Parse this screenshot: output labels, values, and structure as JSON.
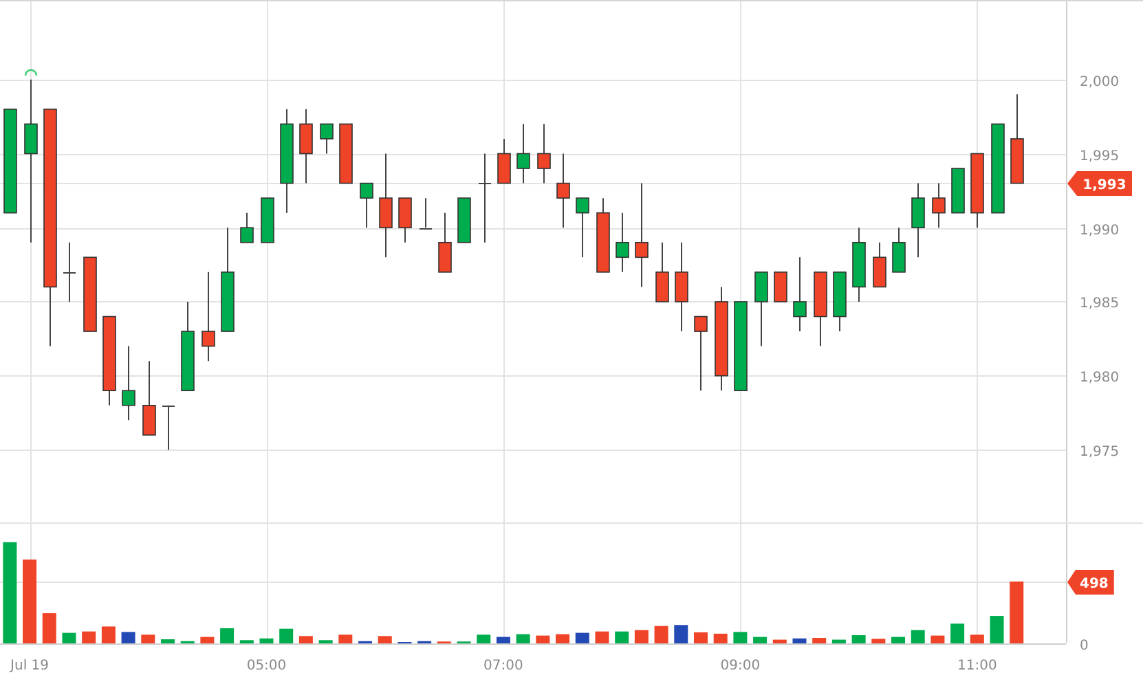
{
  "price_chart": {
    "chart_data": {
      "type": "candlestick",
      "grid": true,
      "categories": [
        null,
        null,
        null,
        null,
        null,
        null,
        null,
        null,
        null,
        null,
        null,
        null,
        null,
        null,
        null,
        null,
        null,
        null,
        null,
        null,
        null,
        null,
        null,
        null,
        null,
        null,
        null,
        null,
        null,
        null,
        null,
        null,
        null,
        null,
        null,
        null,
        null,
        null,
        null,
        null,
        null,
        null,
        null,
        null,
        null,
        null,
        null,
        null,
        null,
        null,
        null,
        null,
        null,
        null
      ],
      "ohlc": [
        [
          1991,
          1998,
          1991,
          1998
        ],
        [
          1995,
          2000,
          1989,
          1997
        ],
        [
          1998,
          1998,
          1982,
          1986
        ],
        [
          1987,
          1989,
          1985,
          1987
        ],
        [
          1988,
          1988,
          1983,
          1983
        ],
        [
          1984,
          1984,
          1978,
          1979
        ],
        [
          1978,
          1982,
          1977,
          1979
        ],
        [
          1978,
          1981,
          1976,
          1976
        ],
        [
          1978,
          1978,
          1975,
          1978
        ],
        [
          1979,
          1985,
          1979,
          1983
        ],
        [
          1983,
          1987,
          1981,
          1982
        ],
        [
          1983,
          1990,
          1983,
          1987
        ],
        [
          1989,
          1991,
          1989,
          1990
        ],
        [
          1989,
          1992,
          1989,
          1992
        ],
        [
          1993,
          1998,
          1991,
          1997
        ],
        [
          1997,
          1998,
          1993,
          1995
        ],
        [
          1996,
          1997,
          1995,
          1997
        ],
        [
          1997,
          1997,
          1993,
          1993
        ],
        [
          1992,
          1993,
          1990,
          1993
        ],
        [
          1992,
          1995,
          1988,
          1990
        ],
        [
          1992,
          1992,
          1989,
          1990
        ],
        [
          1990,
          1992,
          1990,
          1990
        ],
        [
          1989,
          1991,
          1987,
          1987
        ],
        [
          1989,
          1992,
          1989,
          1992
        ],
        [
          1993,
          1995,
          1989,
          1993
        ],
        [
          1995,
          1996,
          1993,
          1993
        ],
        [
          1994,
          1997,
          1993,
          1995
        ],
        [
          1995,
          1997,
          1993,
          1994
        ],
        [
          1993,
          1995,
          1990,
          1992
        ],
        [
          1991,
          1992,
          1988,
          1992
        ],
        [
          1991,
          1992,
          1987,
          1987
        ],
        [
          1988,
          1991,
          1987,
          1989
        ],
        [
          1989,
          1993,
          1986,
          1988
        ],
        [
          1987,
          1989,
          1985,
          1985
        ],
        [
          1987,
          1989,
          1983,
          1985
        ],
        [
          1984,
          1984,
          1979,
          1983
        ],
        [
          1985,
          1986,
          1979,
          1980
        ],
        [
          1979,
          1985,
          1979,
          1985
        ],
        [
          1985,
          1987,
          1982,
          1987
        ],
        [
          1987,
          1987,
          1985,
          1985
        ],
        [
          1984,
          1988,
          1983,
          1985
        ],
        [
          1987,
          1987,
          1982,
          1984
        ],
        [
          1984,
          1987,
          1983,
          1987
        ],
        [
          1986,
          1990,
          1985,
          1989
        ],
        [
          1988,
          1989,
          1986,
          1986
        ],
        [
          1987,
          1990,
          1987,
          1989
        ],
        [
          1990,
          1993,
          1988,
          1992
        ],
        [
          1992,
          1993,
          1990,
          1991
        ],
        [
          1991,
          1994,
          1991,
          1994
        ],
        [
          1995,
          1995,
          1990,
          1991
        ],
        [
          1991,
          1997,
          1991,
          1997
        ],
        [
          1996,
          1999,
          1993,
          1993
        ],
        null,
        null
      ],
      "ylim": [
        1970.1,
        2005.28
      ],
      "yticks": [
        {
          "value": 1975,
          "label": "1,975"
        },
        {
          "value": 1980,
          "label": "1,980"
        },
        {
          "value": 1985,
          "label": "1,985"
        },
        {
          "value": 1990,
          "label": "1,990"
        },
        {
          "value": 1995,
          "label": "1,995"
        },
        {
          "value": 2000,
          "label": "2,000"
        }
      ],
      "annotations": [
        "1,993"
      ]
    }
  },
  "volume_chart": {
    "chart_data": {
      "type": "bar",
      "stacked": true,
      "grid": true,
      "categories": [
        null,
        "Jul 19",
        null,
        null,
        null,
        null,
        null,
        null,
        null,
        null,
        null,
        null,
        null,
        "05:00",
        null,
        null,
        null,
        null,
        null,
        null,
        null,
        null,
        null,
        null,
        null,
        "07:00",
        null,
        null,
        null,
        null,
        null,
        null,
        null,
        null,
        null,
        null,
        null,
        "09:00",
        null,
        null,
        null,
        null,
        null,
        null,
        null,
        null,
        null,
        null,
        null,
        "11:00",
        null,
        null,
        null,
        null
      ],
      "series": [
        {
          "color": "#00ad4e",
          "values": [
            815,
            null,
            null,
            85,
            null,
            null,
            null,
            null,
            33,
            18,
            null,
            122,
            26,
            40,
            118,
            null,
            26,
            null,
            null,
            null,
            null,
            null,
            null,
            15,
            70,
            null,
            74,
            null,
            null,
            null,
            null,
            96,
            null,
            null,
            null,
            null,
            null,
            92,
            52,
            null,
            null,
            null,
            30,
            66,
            null,
            52,
            107,
            null,
            159,
            null,
            221,
            null,
            null,
            null
          ]
        },
        {
          "color": "#f04428",
          "values": [
            null,
            675,
            243,
            null,
            96,
            136,
            null,
            70,
            null,
            null,
            52,
            null,
            null,
            null,
            null,
            59,
            null,
            70,
            null,
            59,
            null,
            null,
            15,
            null,
            null,
            null,
            null,
            63,
            74,
            null,
            96,
            null,
            107,
            140,
            null,
            89,
            78,
            null,
            null,
            30,
            null,
            44,
            null,
            null,
            37,
            null,
            null,
            63,
            null,
            70,
            null,
            498,
            null,
            null
          ]
        },
        {
          "color": "#2349b5",
          "values": [
            null,
            null,
            null,
            null,
            null,
            null,
            92,
            null,
            null,
            null,
            null,
            null,
            null,
            null,
            null,
            null,
            null,
            null,
            18,
            null,
            11,
            18,
            null,
            null,
            null,
            52,
            null,
            null,
            null,
            85,
            null,
            null,
            null,
            null,
            148,
            null,
            null,
            null,
            null,
            null,
            40,
            null,
            null,
            null,
            null,
            null,
            null,
            null,
            null,
            null,
            null,
            null,
            null,
            null
          ]
        }
      ],
      "ylim": [
        0,
        963
      ],
      "yticks": [
        {
          "value": 0,
          "label": "0"
        },
        {
          "value": 498,
          "label": "498"
        }
      ]
    }
  }
}
